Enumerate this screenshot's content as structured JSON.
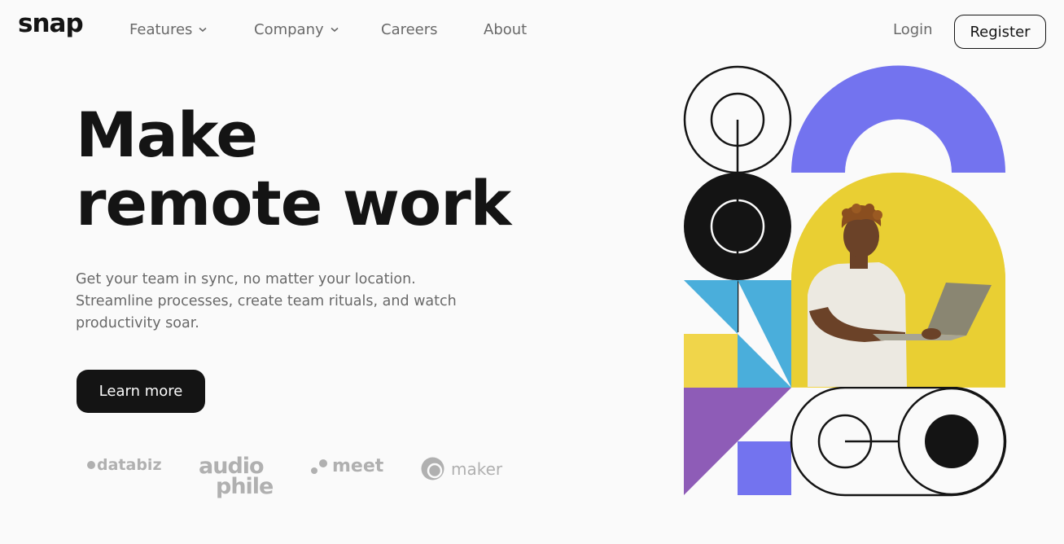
{
  "app": {
    "logo": "snap"
  },
  "nav": {
    "items": [
      {
        "label": "Features",
        "has_dropdown": true
      },
      {
        "label": "Company",
        "has_dropdown": true
      },
      {
        "label": "Careers",
        "has_dropdown": false
      },
      {
        "label": "About",
        "has_dropdown": false
      }
    ],
    "login_label": "Login",
    "register_label": "Register"
  },
  "hero": {
    "title_line1": "Make",
    "title_line2": "remote work",
    "text_line1": "Get your team in sync, no matter your location.",
    "text_line2": "Streamline processes, create team rituals, and watch",
    "text_line3": "productivity soar.",
    "cta_label": "Learn more"
  },
  "clients": {
    "databiz": "databiz",
    "audiophile_1": "audio",
    "audiophile_2": "phile",
    "meet": "meet",
    "maker": "maker"
  },
  "colors": {
    "text_dark": "#141414",
    "text_gray": "#696969",
    "background": "#fafafa",
    "blue": "#4aaedb",
    "yellow": "#f0d54a",
    "purple": "#8e5cb7",
    "indigo": "#7373ef",
    "logo_gray": "#b0b0b0"
  }
}
